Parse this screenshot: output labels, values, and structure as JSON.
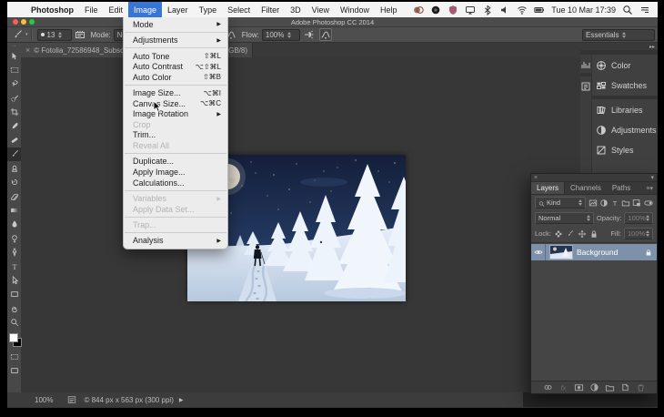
{
  "menubar": {
    "apple_icon": "",
    "items": [
      "Photoshop",
      "File",
      "Edit",
      "Image",
      "Layer",
      "Type",
      "Select",
      "Filter",
      "3D",
      "View",
      "Window",
      "Help"
    ],
    "active_item": "Image",
    "status_icons": [
      "camera-app-icon",
      "record-icon",
      "shield-app-icon",
      "display-icon",
      "bluetooth-icon",
      "volume-icon",
      "wifi-icon",
      "battery-icon"
    ],
    "clock": "Tue 10 Mar 17:39",
    "right_icons": [
      "spotlight-icon",
      "notification-list-icon"
    ]
  },
  "titlebar": {
    "title": "Adobe Photoshop CC 2014"
  },
  "options_bar": {
    "brush_size": "13",
    "mode_label": "Mode:",
    "mode_value": "Normal",
    "flow_label": "Flow:",
    "flow_value": "100%",
    "workspace": "Essentials"
  },
  "document_tab": {
    "close": "×",
    "title_left": "© Fotolia_72586948_Subscr",
    "title_right": "GB/8)"
  },
  "image_menu": {
    "items": [
      {
        "label": "Mode",
        "submenu": true
      },
      {
        "sep": true
      },
      {
        "label": "Adjustments",
        "submenu": true
      },
      {
        "sep": true
      },
      {
        "label": "Auto Tone",
        "shortcut": "⇧⌘L"
      },
      {
        "label": "Auto Contrast",
        "shortcut": "⌥⇧⌘L"
      },
      {
        "label": "Auto Color",
        "shortcut": "⇧⌘B"
      },
      {
        "sep": true
      },
      {
        "label": "Image Size...",
        "shortcut": "⌥⌘I"
      },
      {
        "label": "Canvas Size...",
        "shortcut": "⌥⌘C"
      },
      {
        "label": "Image Rotation",
        "submenu": true
      },
      {
        "label": "Crop",
        "disabled": true
      },
      {
        "label": "Trim..."
      },
      {
        "label": "Reveal All",
        "disabled": true
      },
      {
        "sep": true
      },
      {
        "label": "Duplicate..."
      },
      {
        "label": "Apply Image..."
      },
      {
        "label": "Calculations..."
      },
      {
        "sep": true
      },
      {
        "label": "Variables",
        "submenu": true,
        "disabled": true
      },
      {
        "label": "Apply Data Set...",
        "disabled": true
      },
      {
        "sep": true
      },
      {
        "label": "Trap...",
        "disabled": true
      },
      {
        "sep": true
      },
      {
        "label": "Analysis",
        "submenu": true
      }
    ]
  },
  "toolbar": {
    "tools": [
      "move",
      "rect-marquee",
      "lasso",
      "quick-selection",
      "crop",
      "eyedropper",
      "healing-brush",
      "brush",
      "clone-stamp",
      "history-brush",
      "eraser",
      "gradient",
      "blur",
      "dodge",
      "pen",
      "type",
      "path-selection",
      "shape",
      "hand",
      "zoom"
    ],
    "selected_tool": "brush"
  },
  "dock": {
    "strip_icons": [
      "histogram",
      "properties"
    ],
    "buttons": [
      {
        "icon": "color-wheel",
        "label": "Color"
      },
      {
        "icon": "swatches",
        "label": "Swatches"
      },
      {
        "icon": "libraries",
        "label": "Libraries"
      },
      {
        "icon": "adjustments",
        "label": "Adjustments"
      },
      {
        "icon": "styles",
        "label": "Styles"
      }
    ]
  },
  "layers_panel": {
    "tabs": [
      "Layers",
      "Channels",
      "Paths"
    ],
    "active_tab": "Layers",
    "kind_label": "Kind",
    "filter_icons": [
      "filter-image",
      "filter-adjust",
      "filter-type",
      "filter-folder",
      "filter-smart"
    ],
    "blend_mode": "Normal",
    "opacity_label": "Opacity:",
    "opacity_value": "100%",
    "lock_label": "Lock:",
    "lock_icons": [
      "lock-transparent",
      "lock-paint",
      "lock-move",
      "lock-all"
    ],
    "fill_label": "Fill:",
    "fill_value": "100%",
    "layers": [
      {
        "name": "Background",
        "visible": true,
        "locked": true,
        "selected": true
      }
    ],
    "footer_icons": [
      "link-layers",
      "layer-effects",
      "layer-mask",
      "adjustment-layer",
      "layer-group",
      "new-layer",
      "delete-layer"
    ]
  },
  "status_bar": {
    "zoom": "100%",
    "doc_info": "© 844 px x 563 px (300 ppi)",
    "menu_arrow": "▶"
  },
  "colors": {
    "menubar_highlight": "#3875d7",
    "selected_layer_row": "#7d92aa",
    "panel_bg": "#454545",
    "canvas_bg": "#373737",
    "menu_bg": "#ececec",
    "traffic_red": "#f95f57",
    "traffic_yellow": "#fbbe2e",
    "traffic_green": "#2bc840"
  }
}
